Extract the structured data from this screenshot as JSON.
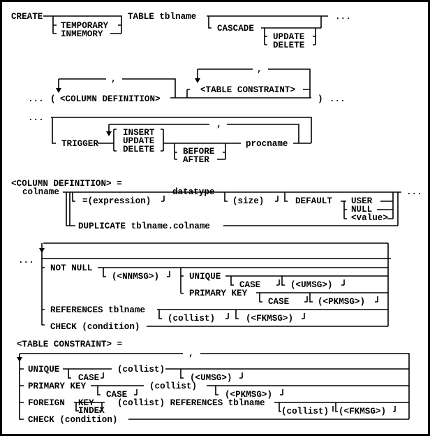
{
  "colors": {
    "foreground": "#000000",
    "background": "#ffffff"
  },
  "create": {
    "create": "CREATE",
    "temporary": "TEMPORARY",
    "inmemory": "INMEMORY",
    "table": "TABLE tblname",
    "cascade": "CASCADE",
    "update": "UPDATE",
    "delete": "DELETE",
    "cont": "..."
  },
  "cols": {
    "cont_in": "...",
    "lparen": "(",
    "coldef": "<COLUMN DEFINITION>",
    "comma1": ",",
    "tcons": "<TABLE CONSTRAINT>",
    "comma2": ",",
    "rparen": ")",
    "cont_out": "..."
  },
  "trigger": {
    "cont_in": "...",
    "trigger": "TRIGGER",
    "comma": ",",
    "insert": "INSERT",
    "update": "UPDATE",
    "delete": "DELETE",
    "before": "BEFORE",
    "after": "AFTER",
    "procname": "procname"
  },
  "coldef": {
    "title": "<COLUMN DEFINITION> =",
    "colname": "colname",
    "expression": "=(expression)",
    "datatype": "datatype",
    "size": "(size)",
    "default": "DEFAULT",
    "user": "USER",
    "null": "NULL",
    "value": "<value>",
    "duplicate": "DUPLICATE tblname.colname",
    "cont": "..."
  },
  "colcons": {
    "cont": "...",
    "notnull": "NOT NULL",
    "nnmsg": "(<NNMSG>)",
    "unique": "UNIQUE",
    "case1": "CASE",
    "umsg": "(<UMSG>)",
    "pk": "PRIMARY KEY",
    "case2": "CASE",
    "pkmsg": "(<PKMSG>)",
    "refs": "REFERENCES tblname",
    "collist": "(collist)",
    "fkmsg": "(<FKMSG>)",
    "check": "CHECK (condition)"
  },
  "tablecons": {
    "title": "<TABLE CONSTRAINT> =",
    "comma": ",",
    "unique": "UNIQUE",
    "case1": "CASE",
    "collist1": "(collist)",
    "umsg": "(<UMSG>)",
    "pk": "PRIMARY KEY",
    "case2": "CASE",
    "collist2": "(collist)",
    "pkmsg": "(<PKMSG>)",
    "foreign": "FOREIGN",
    "key": "KEY",
    "index": "INDEX",
    "refs": "(collist) REFERENCES tblname",
    "collist3": "(collist)",
    "fkmsg": "(<FKMSG>)",
    "check": "CHECK (condition)"
  }
}
